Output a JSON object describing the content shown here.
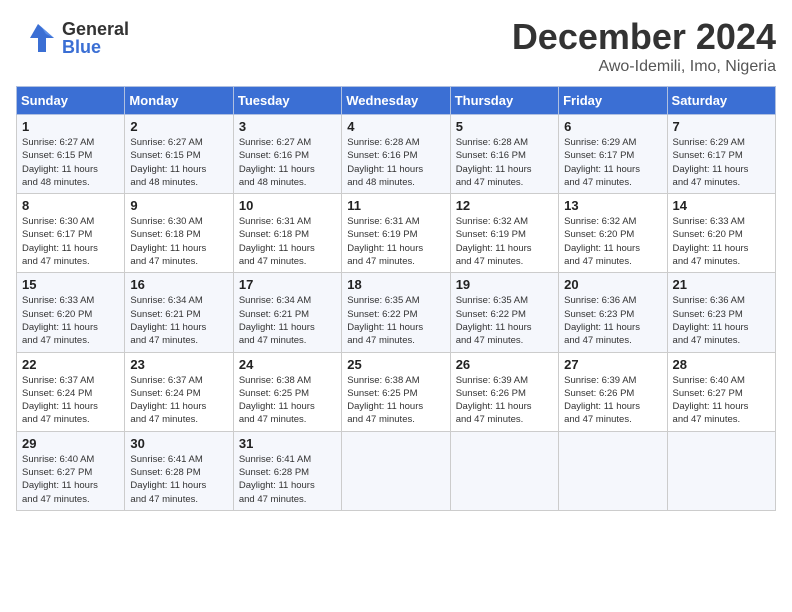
{
  "logo": {
    "general": "General",
    "blue": "Blue"
  },
  "title": "December 2024",
  "subtitle": "Awo-Idemili, Imo, Nigeria",
  "weekdays": [
    "Sunday",
    "Monday",
    "Tuesday",
    "Wednesday",
    "Thursday",
    "Friday",
    "Saturday"
  ],
  "weeks": [
    [
      {
        "day": 1,
        "sunrise": "6:27 AM",
        "sunset": "6:15 PM",
        "daylight": "11 hours and 48 minutes."
      },
      {
        "day": 2,
        "sunrise": "6:27 AM",
        "sunset": "6:15 PM",
        "daylight": "11 hours and 48 minutes."
      },
      {
        "day": 3,
        "sunrise": "6:27 AM",
        "sunset": "6:16 PM",
        "daylight": "11 hours and 48 minutes."
      },
      {
        "day": 4,
        "sunrise": "6:28 AM",
        "sunset": "6:16 PM",
        "daylight": "11 hours and 48 minutes."
      },
      {
        "day": 5,
        "sunrise": "6:28 AM",
        "sunset": "6:16 PM",
        "daylight": "11 hours and 47 minutes."
      },
      {
        "day": 6,
        "sunrise": "6:29 AM",
        "sunset": "6:17 PM",
        "daylight": "11 hours and 47 minutes."
      },
      {
        "day": 7,
        "sunrise": "6:29 AM",
        "sunset": "6:17 PM",
        "daylight": "11 hours and 47 minutes."
      }
    ],
    [
      {
        "day": 8,
        "sunrise": "6:30 AM",
        "sunset": "6:17 PM",
        "daylight": "11 hours and 47 minutes."
      },
      {
        "day": 9,
        "sunrise": "6:30 AM",
        "sunset": "6:18 PM",
        "daylight": "11 hours and 47 minutes."
      },
      {
        "day": 10,
        "sunrise": "6:31 AM",
        "sunset": "6:18 PM",
        "daylight": "11 hours and 47 minutes."
      },
      {
        "day": 11,
        "sunrise": "6:31 AM",
        "sunset": "6:19 PM",
        "daylight": "11 hours and 47 minutes."
      },
      {
        "day": 12,
        "sunrise": "6:32 AM",
        "sunset": "6:19 PM",
        "daylight": "11 hours and 47 minutes."
      },
      {
        "day": 13,
        "sunrise": "6:32 AM",
        "sunset": "6:20 PM",
        "daylight": "11 hours and 47 minutes."
      },
      {
        "day": 14,
        "sunrise": "6:33 AM",
        "sunset": "6:20 PM",
        "daylight": "11 hours and 47 minutes."
      }
    ],
    [
      {
        "day": 15,
        "sunrise": "6:33 AM",
        "sunset": "6:20 PM",
        "daylight": "11 hours and 47 minutes."
      },
      {
        "day": 16,
        "sunrise": "6:34 AM",
        "sunset": "6:21 PM",
        "daylight": "11 hours and 47 minutes."
      },
      {
        "day": 17,
        "sunrise": "6:34 AM",
        "sunset": "6:21 PM",
        "daylight": "11 hours and 47 minutes."
      },
      {
        "day": 18,
        "sunrise": "6:35 AM",
        "sunset": "6:22 PM",
        "daylight": "11 hours and 47 minutes."
      },
      {
        "day": 19,
        "sunrise": "6:35 AM",
        "sunset": "6:22 PM",
        "daylight": "11 hours and 47 minutes."
      },
      {
        "day": 20,
        "sunrise": "6:36 AM",
        "sunset": "6:23 PM",
        "daylight": "11 hours and 47 minutes."
      },
      {
        "day": 21,
        "sunrise": "6:36 AM",
        "sunset": "6:23 PM",
        "daylight": "11 hours and 47 minutes."
      }
    ],
    [
      {
        "day": 22,
        "sunrise": "6:37 AM",
        "sunset": "6:24 PM",
        "daylight": "11 hours and 47 minutes."
      },
      {
        "day": 23,
        "sunrise": "6:37 AM",
        "sunset": "6:24 PM",
        "daylight": "11 hours and 47 minutes."
      },
      {
        "day": 24,
        "sunrise": "6:38 AM",
        "sunset": "6:25 PM",
        "daylight": "11 hours and 47 minutes."
      },
      {
        "day": 25,
        "sunrise": "6:38 AM",
        "sunset": "6:25 PM",
        "daylight": "11 hours and 47 minutes."
      },
      {
        "day": 26,
        "sunrise": "6:39 AM",
        "sunset": "6:26 PM",
        "daylight": "11 hours and 47 minutes."
      },
      {
        "day": 27,
        "sunrise": "6:39 AM",
        "sunset": "6:26 PM",
        "daylight": "11 hours and 47 minutes."
      },
      {
        "day": 28,
        "sunrise": "6:40 AM",
        "sunset": "6:27 PM",
        "daylight": "11 hours and 47 minutes."
      }
    ],
    [
      {
        "day": 29,
        "sunrise": "6:40 AM",
        "sunset": "6:27 PM",
        "daylight": "11 hours and 47 minutes."
      },
      {
        "day": 30,
        "sunrise": "6:41 AM",
        "sunset": "6:28 PM",
        "daylight": "11 hours and 47 minutes."
      },
      {
        "day": 31,
        "sunrise": "6:41 AM",
        "sunset": "6:28 PM",
        "daylight": "11 hours and 47 minutes."
      },
      null,
      null,
      null,
      null
    ]
  ]
}
